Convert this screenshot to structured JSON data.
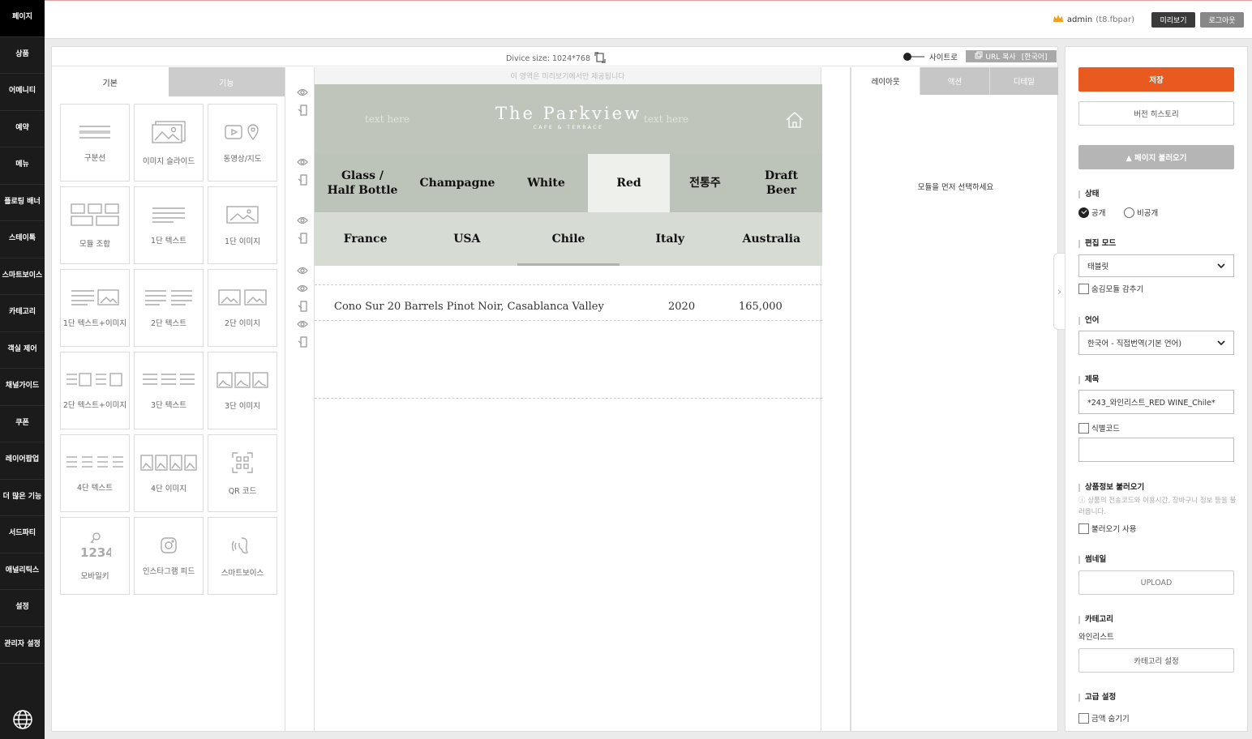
{
  "sidebar": {
    "items": [
      "페이지",
      "상품",
      "어메니티",
      "예약",
      "메뉴",
      "플로팅 배너",
      "스테이톡",
      "스마트보이스",
      "카테고리",
      "객실 제어",
      "채널가이드",
      "쿠폰",
      "레이어팝업",
      "더 많은 기능",
      "서드파티",
      "애널리틱스",
      "설정",
      "관리자 설정"
    ]
  },
  "topbar": {
    "user": "admin",
    "user_sub": "(t8.fbpar)",
    "preview_label": "미리보기",
    "logout_label": "로그아웃"
  },
  "devbar": {
    "device_size": "Divice size: 1024*768",
    "site_toggle_label": "사이트로",
    "url_copy": "URL 복사",
    "url_lang": "[한국어]"
  },
  "modules": {
    "tabs": [
      "기본",
      "기능"
    ],
    "items": [
      {
        "label": "구분선",
        "icon": "divider-icon"
      },
      {
        "label": "이미지 슬라이드",
        "icon": "image-slide-icon"
      },
      {
        "label": "동영상/지도",
        "icon": "video-map-icon"
      },
      {
        "label": "모듈 조합",
        "icon": "module-combo-icon"
      },
      {
        "label": "1단 텍스트",
        "icon": "text-1col-icon"
      },
      {
        "label": "1단 이미지",
        "icon": "image-1col-icon"
      },
      {
        "label": "1단 텍스트+이미지",
        "icon": "text-image-1col-icon"
      },
      {
        "label": "2단 텍스트",
        "icon": "text-2col-icon"
      },
      {
        "label": "2단 이미지",
        "icon": "image-2col-icon"
      },
      {
        "label": "2단 텍스트+이미지",
        "icon": "text-image-2col-icon"
      },
      {
        "label": "3단 텍스트",
        "icon": "text-3col-icon"
      },
      {
        "label": "3단 이미지",
        "icon": "image-3col-icon"
      },
      {
        "label": "4단 텍스트",
        "icon": "text-4col-icon"
      },
      {
        "label": "4단 이미지",
        "icon": "image-4col-icon"
      },
      {
        "label": "QR 코드",
        "icon": "qr-code-icon"
      },
      {
        "label": "모바일키",
        "icon": "mobile-key-icon",
        "icon_text": "1234"
      },
      {
        "label": "인스타그램 피드",
        "icon": "instagram-icon"
      },
      {
        "label": "스마트보이스",
        "icon": "smart-voice-icon"
      }
    ]
  },
  "canvas": {
    "notice": "이 영역은 미리보기에서만 제공됩니다",
    "brand_title": "The Parkview",
    "brand_sub": "CAFE & TERRACE",
    "placeholder": "text here",
    "categories": [
      "Glass /\nHalf Bottle",
      "Champagne",
      "White",
      "Red",
      "전통주",
      "Draft\nBeer"
    ],
    "selected_category": "Red",
    "countries": [
      "France",
      "USA",
      "Chile",
      "Italy",
      "Australia"
    ],
    "selected_country": "Chile",
    "wine": {
      "name": "Cono Sur 20 Barrels Pinot Noir, Casablanca Valley",
      "year": "2020",
      "price": "165,000"
    }
  },
  "props": {
    "tabs": [
      "레이아웃",
      "액션",
      "디테일"
    ],
    "empty_message": "모듈을 먼저 선택하세요"
  },
  "right": {
    "save": "저장",
    "history": "버전 히스토리",
    "load_page": "▲ 페이지 불러오기",
    "status_label": "상태",
    "status_public": "공개",
    "status_private": "비공개",
    "edit_mode_label": "편집 모드",
    "edit_mode_value": "태블릿",
    "hide_modules": "숨김모듈 감추기",
    "lang_label": "언어",
    "lang_value": "한국어 - 직접번역(기본 언어)",
    "title_label": "제목",
    "title_value": "*243_와인리스트_RED WINE_Chile*",
    "idcode_label": "식별코드",
    "product_info_label": "상품정보 불러오기",
    "product_info_hint": "ⓘ 상품의 전송코드와 이용시간, 장바구니 정보 등을 불러옵니다.",
    "product_info_use": "불러오기 사용",
    "thumb_label": "썸네일",
    "upload": "UPLOAD",
    "category_label": "카테고리",
    "category_value": "와인리스트",
    "category_set": "카테고리 설정",
    "advanced_label": "고급 설정",
    "hide_price": "금액 숨기기"
  }
}
